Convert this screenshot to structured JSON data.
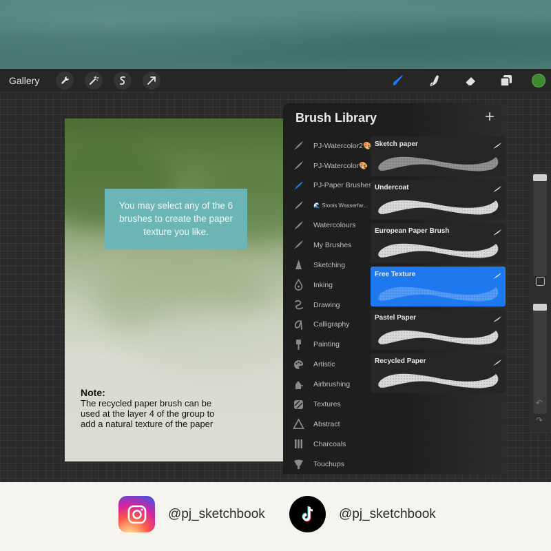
{
  "toolbar": {
    "gallery_label": "Gallery",
    "left_icons": [
      "wrench-icon",
      "magic-wand-icon",
      "selection-icon",
      "transform-arrow-icon"
    ],
    "right_icons": [
      "brush-icon",
      "smudge-icon",
      "eraser-icon",
      "layers-icon"
    ],
    "current_color": "#3d8a33"
  },
  "canvas": {
    "callout_text": "You may select any of the 6 brushes to create the paper texture you like.",
    "note_title": "Note:",
    "note_body": "The recycled paper brush can be used at the layer 4 of the group to add a natural texture of the paper"
  },
  "brush_library": {
    "title": "Brush Library",
    "add_icon": "plus-icon",
    "selected_set": "PJ-Paper Brushes",
    "sets": [
      {
        "label": "PJ-Watercolor2🎨",
        "icon": "feather-icon"
      },
      {
        "label": "PJ-Watercolor🎨",
        "icon": "feather-icon"
      },
      {
        "label": "PJ-Paper Brushes",
        "icon": "feather-icon",
        "selected": true
      },
      {
        "label": "🌊 Stonis Wasserfar...",
        "icon": "feather-icon",
        "small": true
      },
      {
        "label": "Watercolours",
        "icon": "feather-icon"
      },
      {
        "label": "My Brushes",
        "icon": "feather-icon"
      },
      {
        "label": "Sketching",
        "icon": "pencil-tip-icon"
      },
      {
        "label": "Inking",
        "icon": "ink-drop-icon"
      },
      {
        "label": "Drawing",
        "icon": "swirl-icon"
      },
      {
        "label": "Calligraphy",
        "icon": "calligraphy-icon"
      },
      {
        "label": "Painting",
        "icon": "paintbrush-icon"
      },
      {
        "label": "Artistic",
        "icon": "palette-icon"
      },
      {
        "label": "Airbrushing",
        "icon": "airbrush-icon"
      },
      {
        "label": "Textures",
        "icon": "texture-icon"
      },
      {
        "label": "Abstract",
        "icon": "triangle-icon"
      },
      {
        "label": "Charcoals",
        "icon": "charcoal-icon"
      },
      {
        "label": "Touchups",
        "icon": "touchup-icon"
      }
    ],
    "brushes": [
      {
        "name": "Sketch paper",
        "selected": false
      },
      {
        "name": "Undercoat",
        "selected": false
      },
      {
        "name": "European Paper Brush",
        "selected": false
      },
      {
        "name": "Free Texture",
        "selected": true
      },
      {
        "name": "Pastel Paper",
        "selected": false
      },
      {
        "name": "Recycled Paper",
        "selected": false
      }
    ]
  },
  "footer": {
    "instagram_handle": "@pj_sketchbook",
    "tiktok_handle": "@pj_sketchbook"
  },
  "colors": {
    "accent_blue": "#1e78f0",
    "callout_bg": "#6bb5b7"
  }
}
